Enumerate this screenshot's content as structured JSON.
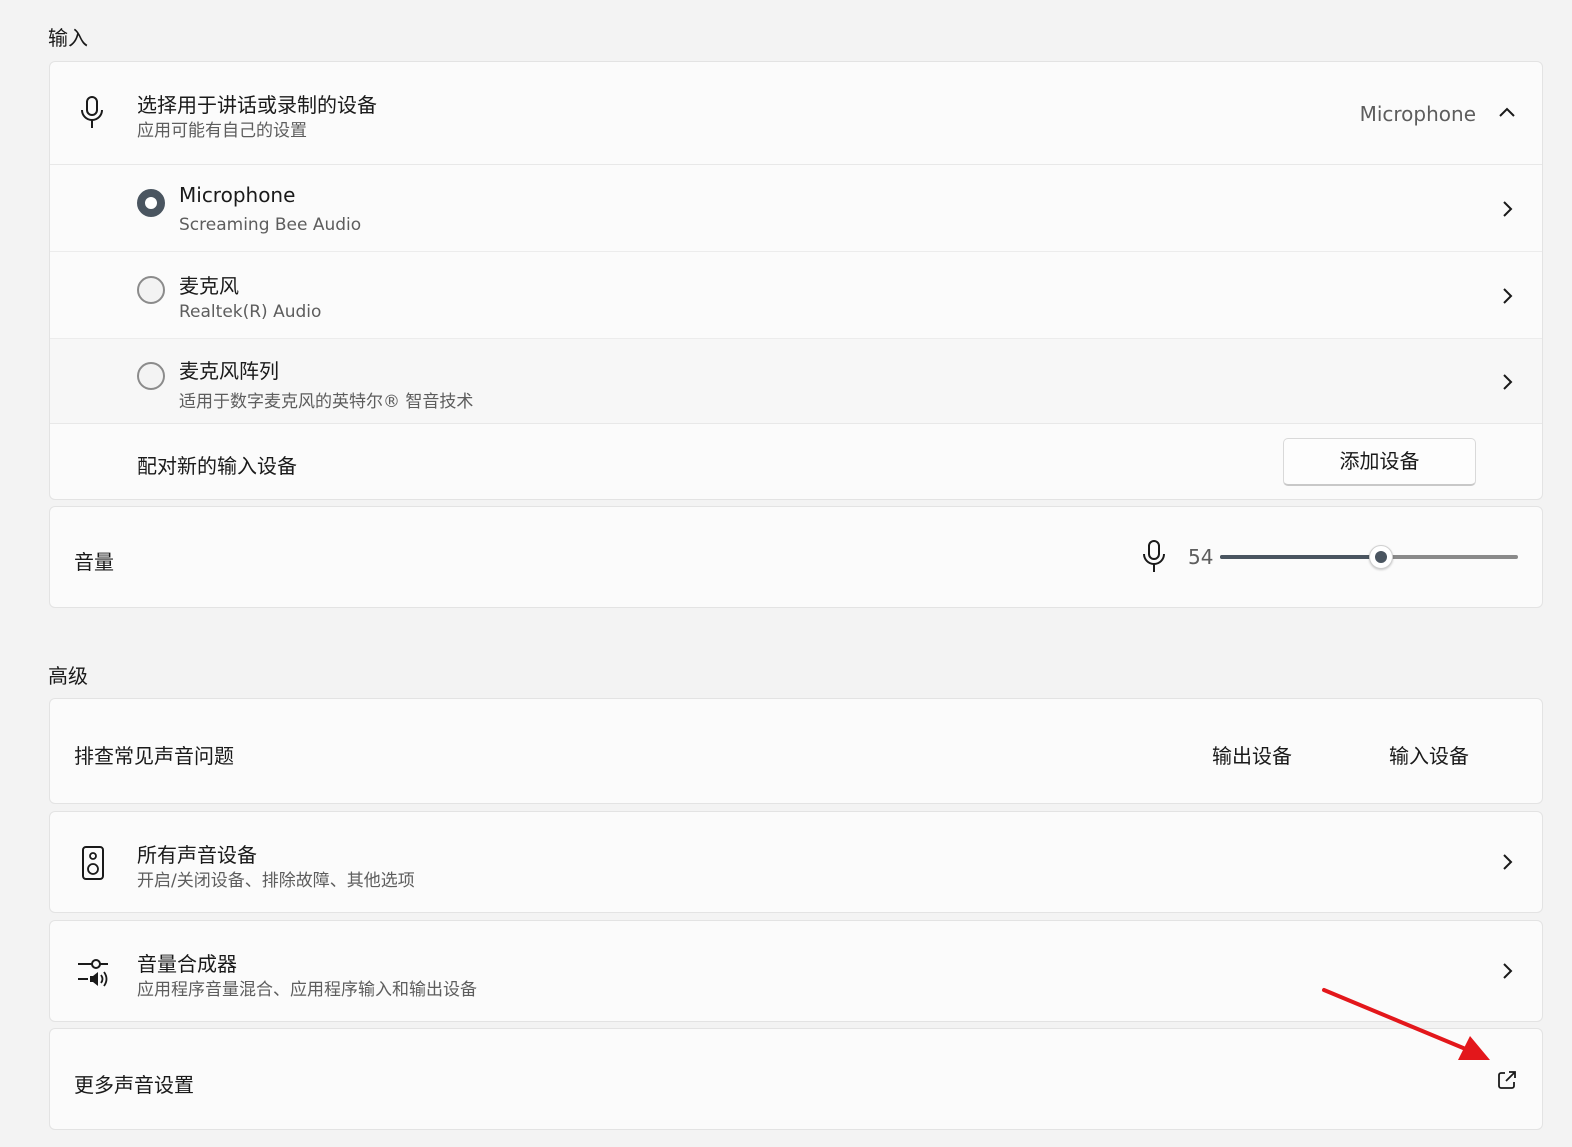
{
  "input_section": {
    "title": "输入",
    "device_select": {
      "title": "选择用于讲话或录制的设备",
      "subtitle": "应用可能有自己的设置",
      "selected_value": "Microphone"
    },
    "devices": [
      {
        "name": "Microphone",
        "detail": "Screaming Bee Audio",
        "selected": true
      },
      {
        "name": "麦克风",
        "detail": "Realtek(R) Audio",
        "selected": false
      },
      {
        "name": "麦克风阵列",
        "detail": "适用于数字麦克风的英特尔® 智音技术",
        "selected": false
      }
    ],
    "pair": {
      "label": "配对新的输入设备",
      "button_label": "添加设备"
    },
    "volume": {
      "label": "音量",
      "value": "54",
      "level_percent": 54
    }
  },
  "advanced_section": {
    "title": "高级",
    "troubleshoot": {
      "label": "排查常见声音问题",
      "output_button": "输出设备",
      "input_button": "输入设备"
    },
    "all_devices": {
      "title": "所有声音设备",
      "subtitle": "开启/关闭设备、排除故障、其他选项"
    },
    "mixer": {
      "title": "音量合成器",
      "subtitle": "应用程序音量混合、应用程序输入和输出设备"
    },
    "more": {
      "label": "更多声音设置"
    }
  },
  "colors": {
    "accent_slider": "#4a5560",
    "annotation_arrow": "#e3171b"
  }
}
